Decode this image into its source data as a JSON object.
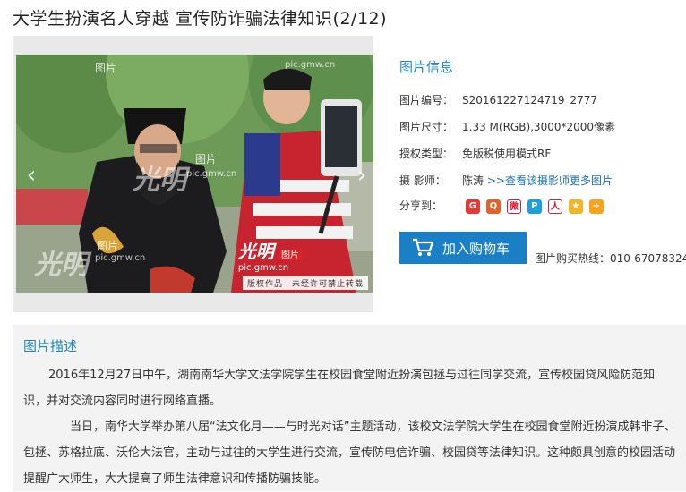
{
  "page": {
    "title": "大学生扮演名人穿越 宣传防诈骗法律知识(2/12)"
  },
  "photo": {
    "watermarks": [
      "图片",
      "图片",
      "图片"
    ],
    "logo_text": "光明",
    "logo_label": "图片",
    "site": "pic.gmw.cn",
    "copyright": "版权作品　未经许可禁止转载",
    "prev_icon": "chevron-left-icon",
    "next_icon": "chevron-right-icon"
  },
  "info": {
    "heading": "图片信息",
    "id_label": "图片编号：",
    "id_value": "S20161227124719_2777",
    "size_label": "图片尺寸：",
    "size_value": "1.33 M(RGB),3000*2000像素",
    "license_label": "授权类型：",
    "license_value": "免版税使用模式RF",
    "photographer_label": "摄  影师：",
    "photographer_value": "陈涛",
    "more_link": ">>查看该摄影师更多图片",
    "share_label": "分享到：",
    "share_icons": [
      "google-icon",
      "qzone-icon",
      "weibo-icon",
      "pengyou-icon",
      "renren-icon",
      "favorite-icon",
      "more-share-icon"
    ]
  },
  "cart": {
    "label": "加入购物车",
    "icon": "cart-icon",
    "hotline": "图片购买热线：010-67078324"
  },
  "description": {
    "heading": "图片描述",
    "para1": "2016年12月27日中午，湖南南华大学文法学院学生在校园食堂附近扮演包拯与过往同学交流，宣传校园贷风险防范知识，并对交流内容同时进行网络直播。",
    "para2": "当日，南华大学举办第八届“法文化月——与时光对话”主题活动，该校文法学院大学生在校园食堂附近扮演成韩非子、包拯、苏格拉底、沃伦大法官，主动与过往的大学生进行交流，宣传防电信诈骗、校园贷等法律知识。这种颇具创意的校园活动提醒广大师生，大大提高了师生法律意识和传播防骗技能。"
  },
  "colors": {
    "accent": "#1a85c6",
    "button": "#1b7fc5",
    "panel": "#f3f3f3"
  }
}
